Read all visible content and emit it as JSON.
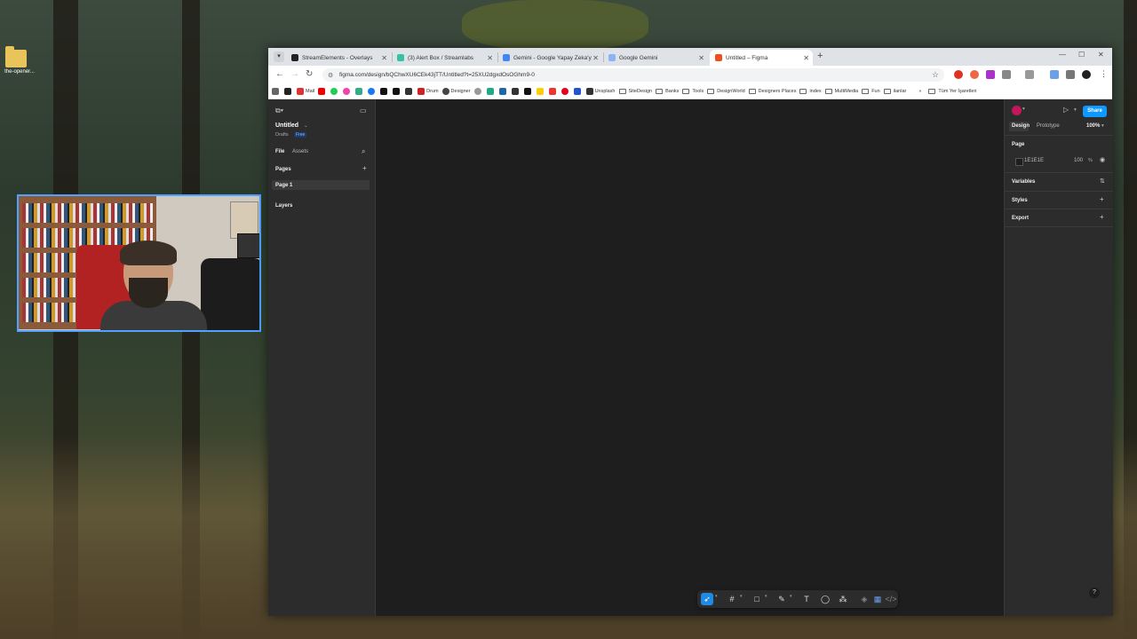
{
  "desktop": {
    "folder_label": "the-opener..."
  },
  "browser": {
    "tabs": [
      {
        "label": "StreamElements - Overlays",
        "color": "#222222"
      },
      {
        "label": "(3) Alert Box / Streamlabs",
        "color": "#31c3a2"
      },
      {
        "label": "Gemini - Google Yapay Zeka'y...",
        "color": "#4285f4"
      },
      {
        "label": "Google Gemini",
        "color": "#8ab4f8"
      },
      {
        "label": "Untitled – Figma",
        "color": "#f24e1e"
      }
    ],
    "url": "figma.com/design/bQChwXU6CEk43jTT/Untitled?t=25XU2dgxdOsOGhm9-0",
    "bookmarks": [
      "Mail",
      "Drum",
      "Designer",
      "Unsplash",
      "SiteDesign",
      "Banks",
      "Tools",
      "DesignWorld",
      "Designers Places",
      "index",
      "MultiMedia",
      "Fun",
      "ilanlar"
    ],
    "bookmarks_more": "»",
    "all_bookmarks": "Tüm Yer İşaretleri"
  },
  "figma": {
    "file_title": "Untitled",
    "location": "Drafts",
    "plan_badge": "Free",
    "left_tabs": {
      "file": "File",
      "assets": "Assets"
    },
    "pages_heading": "Pages",
    "pages": [
      "Page 1"
    ],
    "layers_heading": "Layers",
    "right_tabs": {
      "design": "Design",
      "prototype": "Prototype"
    },
    "zoom": "100%",
    "share_label": "Share",
    "page_section": "Page",
    "page_color": "1E1E1E",
    "page_opacity": "100",
    "percent": "%",
    "variables_label": "Variables",
    "styles_label": "Styles",
    "export_label": "Export",
    "help": "?"
  }
}
